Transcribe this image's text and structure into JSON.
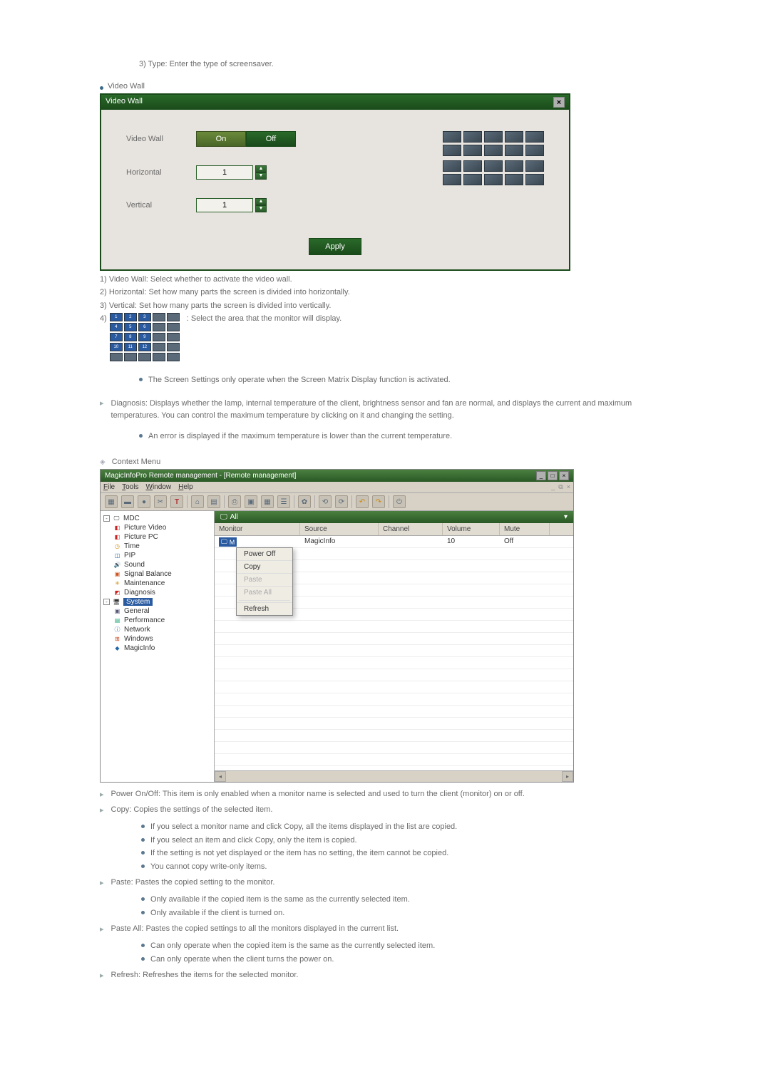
{
  "top_line": "3) Type: Enter the type of screensaver.",
  "video_wall_heading": "Video Wall",
  "vw": {
    "title": "Video Wall",
    "label_videowall": "Video Wall",
    "on": "On",
    "off": "Off",
    "label_horizontal": "Horizontal",
    "horizontal_value": "1",
    "label_vertical": "Vertical",
    "vertical_value": "1",
    "apply": "Apply"
  },
  "vw_notes": {
    "n1": "1) Video Wall: Select whether to activate the video wall.",
    "n2": "2) Horizontal: Set how many parts the screen is divided into horizontally.",
    "n3": "3) Vertical: Set how many parts the screen is divided into vertically.",
    "n4_prefix": "4)",
    "n4_text": ": Select the area that the monitor will display."
  },
  "screen_note": "The Screen Settings only operate when the Screen Matrix Display function is activated.",
  "diagnosis": "Diagnosis: Displays whether the lamp, internal temperature of the client, brightness sensor and fan are normal, and displays the current and maximum temperatures. You can control the maximum temperature by clicking on it and changing the setting.",
  "diag_sub": "An error is displayed if the maximum temperature is lower than the current temperature.",
  "context_menu_heading": "Context Menu",
  "cm": {
    "title": "MagicInfoPro Remote management - [Remote management]",
    "menus": {
      "file": "File",
      "tools": "Tools",
      "window": "Window",
      "help": "Help"
    },
    "tree_root": "MDC",
    "tree": {
      "picture_video": "Picture Video",
      "picture_pc": "Picture PC",
      "time": "Time",
      "pip": "PIP",
      "sound": "Sound",
      "signal_balance": "Signal Balance",
      "maintenance": "Maintenance",
      "diagnosis": "Diagnosis",
      "system": "System",
      "general": "General",
      "performance": "Performance",
      "network": "Network",
      "windows": "Windows",
      "magicinfo": "MagicInfo"
    },
    "tab_all": "All",
    "cols": {
      "monitor": "Monitor",
      "source": "Source",
      "channel": "Channel",
      "volume": "Volume",
      "mute": "Mute"
    },
    "row": {
      "monitor": "M",
      "source": "MagicInfo",
      "channel": "",
      "volume": "10",
      "mute": "Off"
    },
    "ctx": {
      "power_off": "Power Off",
      "copy": "Copy",
      "paste": "Paste",
      "paste_all": "Paste All",
      "refresh": "Refresh"
    }
  },
  "after": {
    "power": "Power On/Off: This item is only enabled when a monitor name is selected and used to turn the client (monitor) on or off.",
    "copy": "Copy: Copies the settings of the selected item.",
    "copy_subs": [
      "If you select a monitor name and click Copy, all the items displayed in the list are copied.",
      "If you select an item and click Copy, only the item is copied.",
      "If the setting is not yet displayed or the item has no setting, the item cannot be copied.",
      "You cannot copy write-only items."
    ],
    "paste": "Paste: Pastes the copied setting to the monitor.",
    "paste_subs": [
      "Only available if the copied item is the same as the currently selected item.",
      "Only available if the client is turned on."
    ],
    "paste_all": "Paste All: Pastes the copied settings to all the monitors displayed in the current list.",
    "paste_all_subs": [
      "Can only operate when the copied item is the same as the currently selected item.",
      "Can only operate when the client turns the power on."
    ],
    "refresh": "Refresh: Refreshes the items for the selected monitor."
  }
}
